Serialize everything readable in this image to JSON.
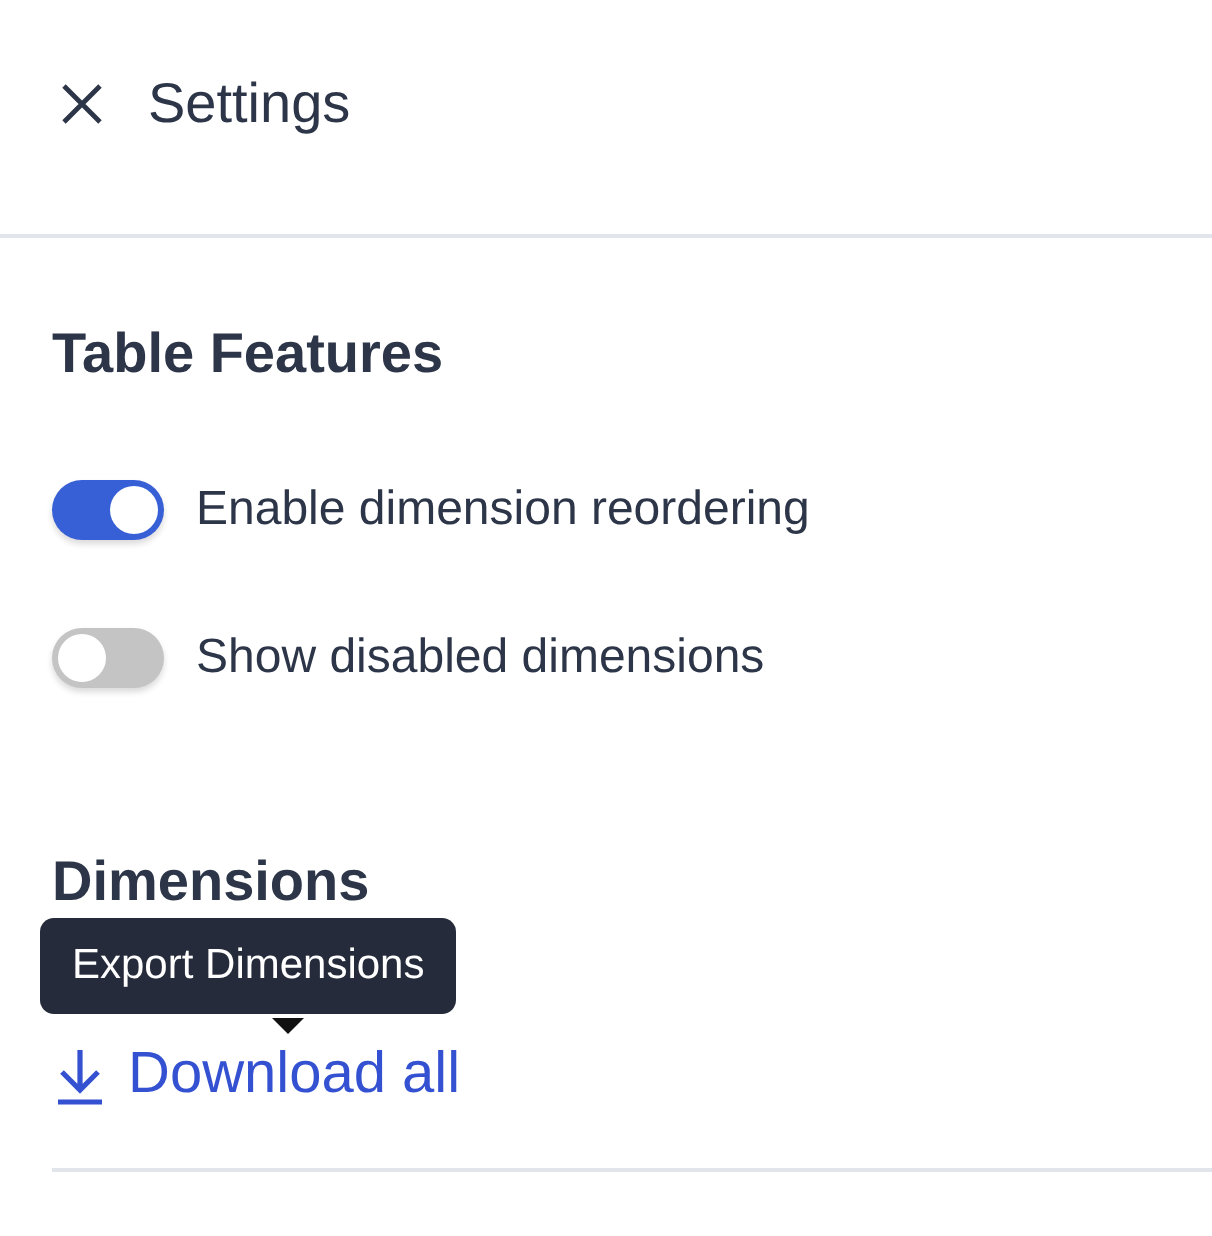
{
  "header": {
    "title": "Settings"
  },
  "table_features": {
    "heading": "Table Features",
    "toggles": [
      {
        "label": "Enable dimension reordering",
        "on": true
      },
      {
        "label": "Show disabled dimensions",
        "on": false
      }
    ]
  },
  "dimensions": {
    "heading": "Dimensions",
    "tooltip": "Export Dimensions",
    "download_link": "Download all"
  }
}
